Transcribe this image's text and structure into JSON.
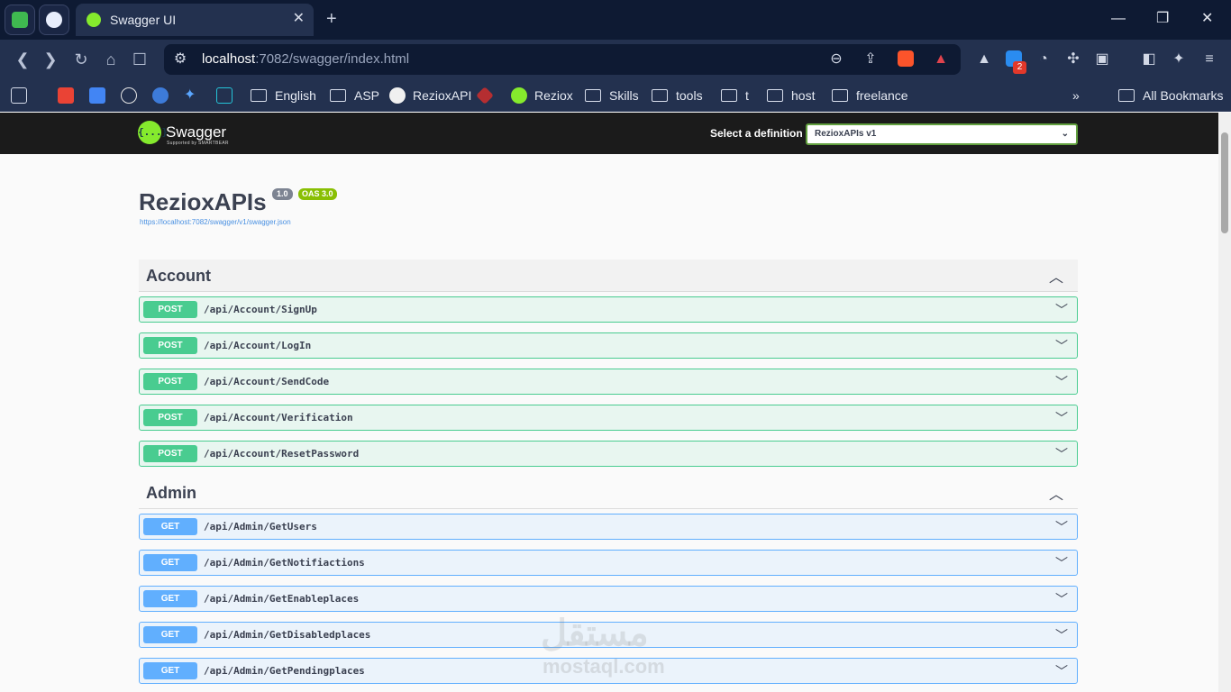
{
  "browser": {
    "tab_title": "Swagger UI",
    "tab_close": "✕",
    "new_tab": "+",
    "window_controls": [
      "—",
      "❐",
      "✕"
    ],
    "url_host": "localhost",
    "url_rest": ":7082/swagger/index.html",
    "extension_badge": "2",
    "bookmarks": [
      {
        "label": "English",
        "icon": "folder-icon"
      },
      {
        "label": "ASP",
        "icon": "folder-icon"
      },
      {
        "label": "RezioxAPI",
        "icon": "github-icon"
      },
      {
        "label": "Reziox",
        "icon": "swagger-icon"
      },
      {
        "label": "Skills",
        "icon": "folder-icon"
      },
      {
        "label": "tools",
        "icon": "folder-icon"
      },
      {
        "label": "t",
        "icon": "folder-icon"
      },
      {
        "label": "host",
        "icon": "folder-icon"
      },
      {
        "label": "freelance",
        "icon": "folder-icon"
      }
    ],
    "more_bookmarks": "»",
    "all_bookmarks": "All Bookmarks"
  },
  "swagger": {
    "logo_text": "{...}",
    "brand": "Swagger",
    "brand_sub": "Supported by SMARTBEAR",
    "select_label": "Select a definition",
    "selected_definition": "RezioxAPIs v1",
    "api_title": "RezioxAPIs",
    "version": "1.0",
    "oas": "OAS 3.0",
    "spec_url": "https://localhost:7082/swagger/v1/swagger.json"
  },
  "sections": [
    {
      "name": "Account",
      "operations": [
        {
          "method": "POST",
          "path": "/api/Account/SignUp"
        },
        {
          "method": "POST",
          "path": "/api/Account/LogIn"
        },
        {
          "method": "POST",
          "path": "/api/Account/SendCode"
        },
        {
          "method": "POST",
          "path": "/api/Account/Verification"
        },
        {
          "method": "POST",
          "path": "/api/Account/ResetPassword"
        }
      ]
    },
    {
      "name": "Admin",
      "operations": [
        {
          "method": "GET",
          "path": "/api/Admin/GetUsers"
        },
        {
          "method": "GET",
          "path": "/api/Admin/GetNotifiactions"
        },
        {
          "method": "GET",
          "path": "/api/Admin/GetEnableplaces"
        },
        {
          "method": "GET",
          "path": "/api/Admin/GetDisabledplaces"
        },
        {
          "method": "GET",
          "path": "/api/Admin/GetPendingplaces"
        }
      ]
    }
  ],
  "watermark": {
    "arabic": "مستقل",
    "latin": "mostaql.com"
  },
  "colors": {
    "post": "#49cc90",
    "get": "#61affe",
    "brand": "#85ea2d"
  }
}
